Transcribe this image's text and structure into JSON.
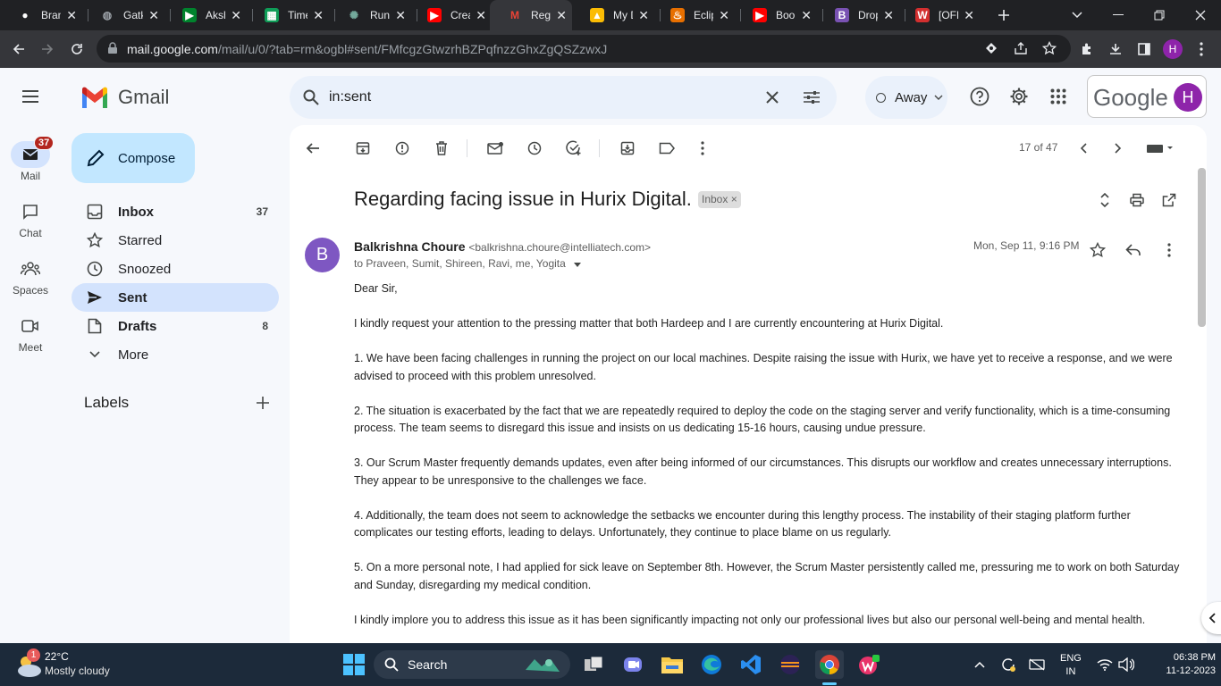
{
  "tabs": [
    {
      "label": "Bran",
      "icon": "github-icon",
      "color": "#ffffff"
    },
    {
      "label": "Gatk",
      "icon": "globe-icon",
      "color": "#9aa0a6"
    },
    {
      "label": "Aksh",
      "icon": "google-meet-icon",
      "color": "#00832d"
    },
    {
      "label": "Time",
      "icon": "google-sheets-icon",
      "color": "#0f9d58"
    },
    {
      "label": "Run",
      "icon": "chatgpt-icon",
      "color": "#74aa9c"
    },
    {
      "label": "Crea",
      "icon": "youtube-icon",
      "color": "#ff0000"
    },
    {
      "label": "Rega",
      "icon": "gmail-icon",
      "color": "#ea4335",
      "active": true
    },
    {
      "label": "My D",
      "icon": "google-drive-icon",
      "color": "#fbbc04"
    },
    {
      "label": "Eclip",
      "icon": "java-icon",
      "color": "#e76f00"
    },
    {
      "label": "Boo",
      "icon": "youtube-icon",
      "color": "#ff0000"
    },
    {
      "label": "Drop",
      "icon": "bootstrap-icon",
      "color": "#7952b3"
    },
    {
      "label": "[OFF",
      "icon": "w-logo-icon",
      "color": "#d32f2f"
    }
  ],
  "browser": {
    "url_domain": "mail.google.com",
    "url_path": "/mail/u/0/?tab=rm&ogbl#sent/FMfcgzGtwzrhBZPqfnzzGhxZgQSZzwxJ",
    "profile_letter": "H"
  },
  "gmail": {
    "logo_text": "Gmail",
    "search_value": "in:sent",
    "status": "Away",
    "google_text": "Google",
    "account_letter": "H"
  },
  "rail": [
    {
      "label": "Mail",
      "icon": "mail-icon",
      "badge": "37"
    },
    {
      "label": "Chat",
      "icon": "chat-icon"
    },
    {
      "label": "Spaces",
      "icon": "spaces-icon"
    },
    {
      "label": "Meet",
      "icon": "meet-icon"
    }
  ],
  "compose_label": "Compose",
  "nav": [
    {
      "label": "Inbox",
      "count": "37",
      "icon": "inbox-icon"
    },
    {
      "label": "Starred",
      "count": "",
      "icon": "star-icon"
    },
    {
      "label": "Snoozed",
      "count": "",
      "icon": "clock-icon"
    },
    {
      "label": "Sent",
      "count": "",
      "icon": "send-icon"
    },
    {
      "label": "Drafts",
      "count": "8",
      "icon": "draft-icon"
    },
    {
      "label": "More",
      "count": "",
      "icon": "chevron-down-icon"
    }
  ],
  "labels_heading": "Labels",
  "email": {
    "pager": "17 of 47",
    "subject": "Regarding facing issue in Hurix Digital.",
    "tag": "Inbox",
    "avatar_letter": "B",
    "sender_name": "Balkrishna Choure",
    "sender_email": "<balkrishna.choure@intelliatech.com>",
    "recipients": "to Praveen, Sumit, Shireen, Ravi, me, Yogita",
    "date": "Mon, Sep 11, 9:16 PM",
    "paragraphs": [
      "Dear Sir,",
      "I kindly request your attention to the pressing matter that both Hardeep and I are currently encountering at Hurix Digital.",
      "1. We have been facing challenges in running the project on our local machines. Despite raising the issue with Hurix, we have yet to receive a response, and we were advised to proceed with this problem unresolved.",
      "2. The situation is exacerbated by the fact that we are repeatedly required to deploy the code on the staging server and verify functionality, which is a time-consuming process. The team seems to disregard this issue and insists on us dedicating 15-16 hours, causing undue pressure.",
      "3. Our Scrum Master frequently demands updates, even after being informed of our circumstances. This disrupts our workflow and creates unnecessary interruptions. They appear to be unresponsive to the challenges we face.",
      "4. Additionally, the team does not seem to acknowledge the setbacks we encounter during this lengthy process. The instability of their staging platform further complicates our testing efforts, leading to delays. Unfortunately, they continue to place blame on us regularly.",
      "5. On a more personal note, I had applied for sick leave on September 8th. However, the Scrum Master persistently called me, pressuring me to work on both Saturday and Sunday, disregarding my medical condition.",
      "I kindly implore you to address this issue as it has been significantly impacting not only our professional lives but also our personal well-being and mental health."
    ]
  },
  "taskbar": {
    "weather_temp": "22°C",
    "weather_desc": "Mostly cloudy",
    "weather_badge": "1",
    "search_label": "Search",
    "lang": "ENG",
    "region": "IN",
    "time": "06:38 PM",
    "date": "11-12-2023"
  }
}
